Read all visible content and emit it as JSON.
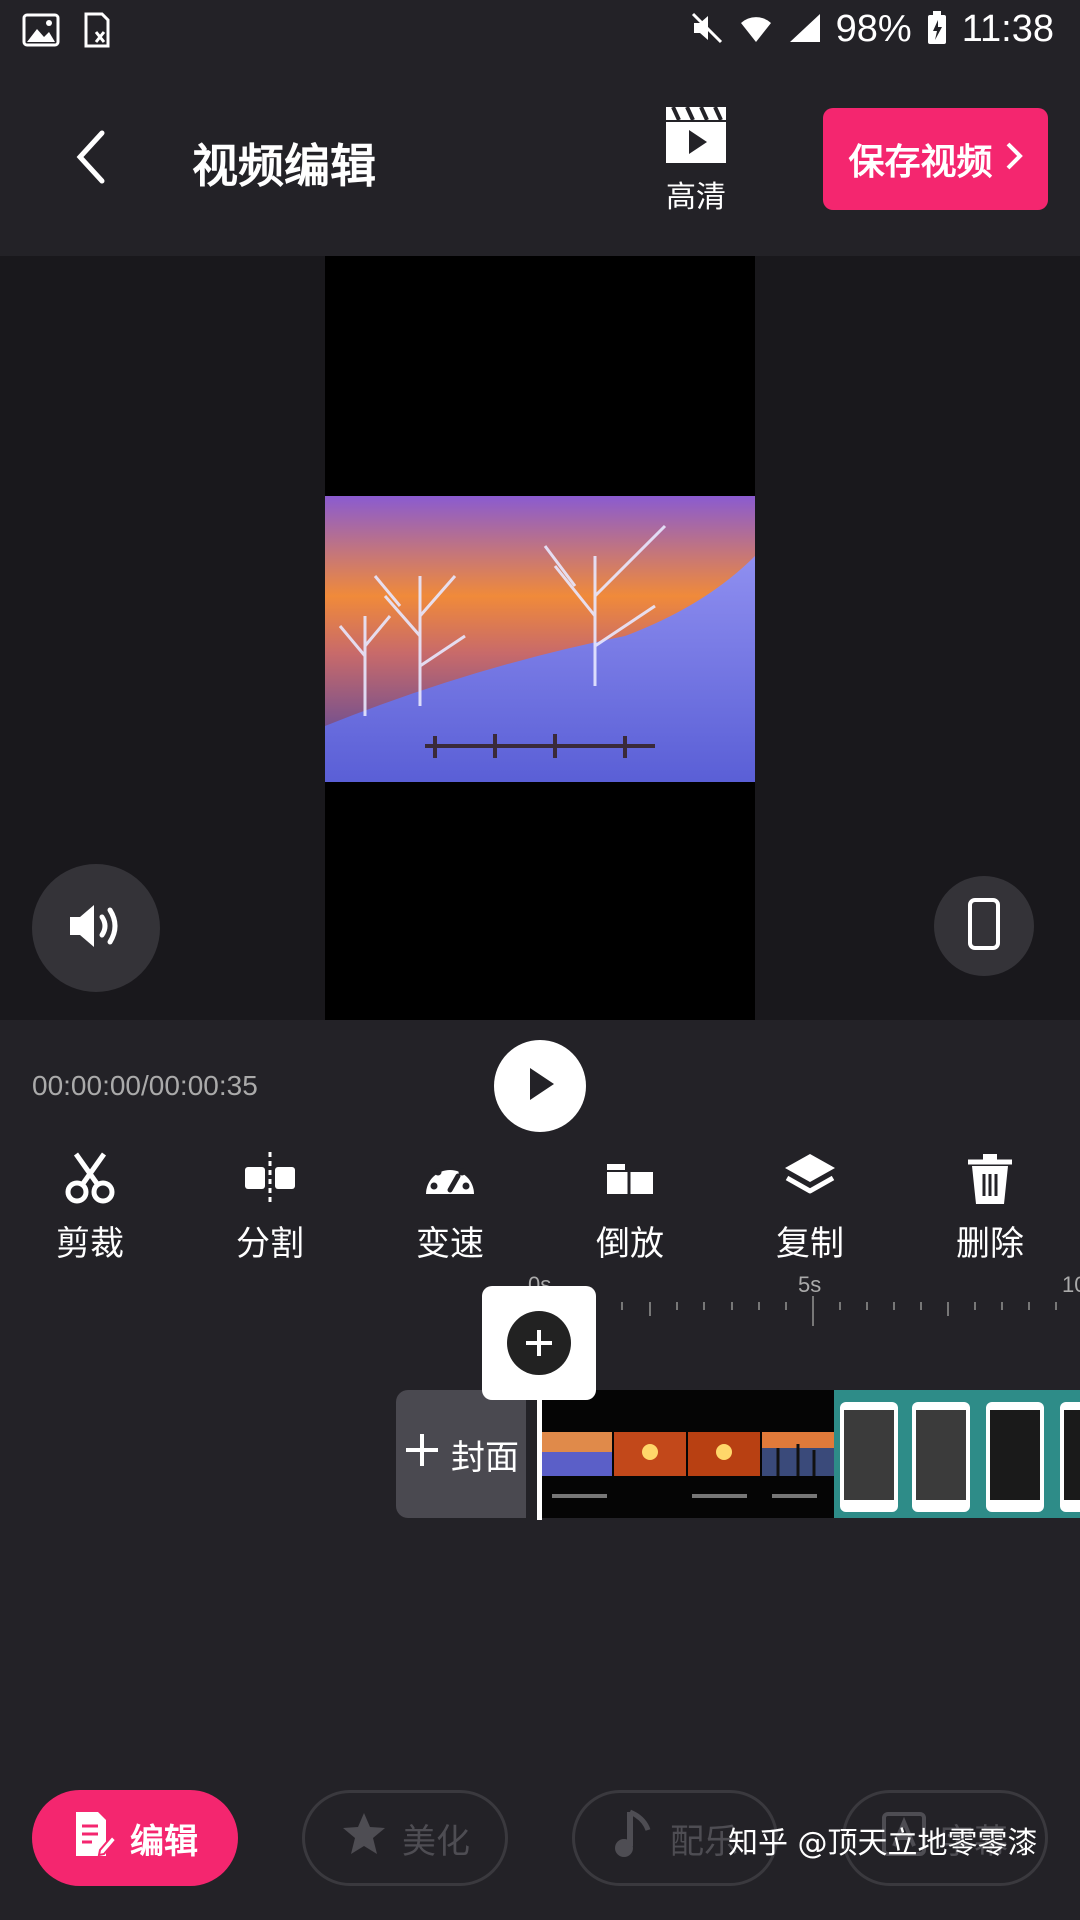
{
  "status_bar": {
    "battery": "98%",
    "time": "11:38"
  },
  "header": {
    "title": "视频编辑",
    "hd_label": "高清",
    "save_label": "保存视频"
  },
  "player": {
    "timecode": "00:00:00/00:00:35"
  },
  "tools": [
    {
      "label": "剪裁",
      "icon": "scissors-icon"
    },
    {
      "label": "分割",
      "icon": "split-icon"
    },
    {
      "label": "变速",
      "icon": "speedometer-icon"
    },
    {
      "label": "倒放",
      "icon": "reverse-icon"
    },
    {
      "label": "复制",
      "icon": "layers-icon"
    },
    {
      "label": "删除",
      "icon": "trash-icon"
    }
  ],
  "ruler": {
    "labels": [
      "0s",
      "5s",
      "10"
    ]
  },
  "timeline": {
    "cover_label": "封面"
  },
  "bottom_nav": [
    {
      "label": "编辑",
      "active": true,
      "icon": "edit-doc-icon"
    },
    {
      "label": "美化",
      "active": false,
      "icon": "star-icon"
    },
    {
      "label": "配乐",
      "active": false,
      "icon": "music-note-icon"
    },
    {
      "label": "字幕",
      "active": false,
      "icon": "text-a-icon"
    }
  ],
  "watermark": "知乎 @顶天立地零零漆",
  "colors": {
    "accent": "#f4266f",
    "background": "#232227"
  }
}
